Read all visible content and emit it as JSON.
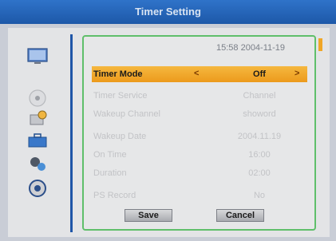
{
  "window": {
    "title": "Timer Setting"
  },
  "header": {
    "clock": "15:58 2004-11-19"
  },
  "sidebar": {
    "icons": [
      {
        "name": "tv-icon"
      },
      {
        "name": "disc-icon"
      },
      {
        "name": "tools-icon"
      },
      {
        "name": "toolbox-icon"
      },
      {
        "name": "media-icon"
      },
      {
        "name": "settings-icon"
      }
    ]
  },
  "form": {
    "rows": [
      {
        "label": "Timer Mode",
        "value": "Off"
      },
      {
        "label": "Timer Service",
        "value": "Channel"
      },
      {
        "label": "Wakeup Channel",
        "value": "showord"
      },
      {
        "label": "Wakeup Date",
        "value": "2004.11.19"
      },
      {
        "label": "On Time",
        "value": "16:00"
      },
      {
        "label": "Duration",
        "value": "02:00"
      },
      {
        "label": "PS Record",
        "value": "No"
      }
    ],
    "arrows": {
      "left": "<",
      "right": ">"
    }
  },
  "buttons": {
    "save": "Save",
    "cancel": "Cancel"
  },
  "colors": {
    "accent": "#1d58a8",
    "highlight": "#f1a52a",
    "panel_border": "#5fbf6a"
  }
}
